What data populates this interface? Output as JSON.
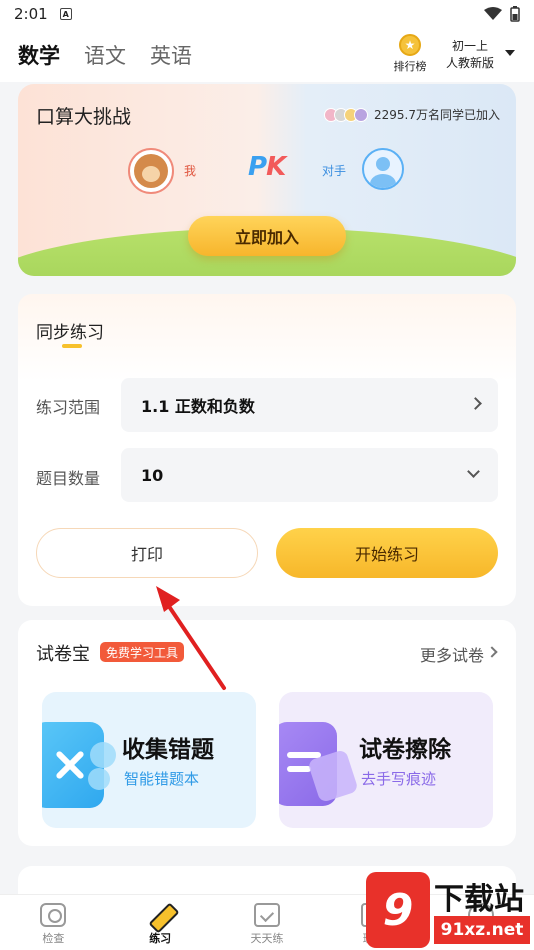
{
  "status_bar": {
    "time": "2:01",
    "app_badge": "A"
  },
  "header": {
    "tabs": [
      {
        "label": "数学",
        "active": true
      },
      {
        "label": "语文",
        "active": false
      },
      {
        "label": "英语",
        "active": false
      }
    ],
    "rank_label": "排行榜",
    "grade_line1": "初一上",
    "grade_line2": "人教新版"
  },
  "challenge": {
    "title": "口算大挑战",
    "joined_text": "2295.7万名同学已加入",
    "me_label": "我",
    "pk_p": "P",
    "pk_k": "K",
    "opponent_label": "对手",
    "join_button": "立即加入"
  },
  "practice": {
    "title": "同步练习",
    "range_label": "练习范围",
    "range_value": "1.1 正数和负数",
    "count_label": "题目数量",
    "count_value": "10",
    "print_button": "打印",
    "start_button": "开始练习"
  },
  "paper": {
    "title": "试卷宝",
    "badge": "免费学习工具",
    "more_link": "更多试卷",
    "tools": [
      {
        "title": "收集错题",
        "subtitle": "智能错题本"
      },
      {
        "title": "试卷擦除",
        "subtitle": "去手写痕迹"
      }
    ]
  },
  "bottom_nav": [
    {
      "label": "检查",
      "icon": "camera-icon",
      "active": false
    },
    {
      "label": "练习",
      "icon": "pencil-icon",
      "active": true
    },
    {
      "label": "天天练",
      "icon": "checklist-icon",
      "active": false
    },
    {
      "label": "班级",
      "icon": "class-icon",
      "active": false
    },
    {
      "label": "",
      "icon": "profile-icon",
      "active": false
    }
  ],
  "watermark": {
    "logo": "9",
    "text": "下载站",
    "url": "91xz.net"
  },
  "colors": {
    "accent_yellow": "#f7b72a",
    "annotation_red": "#e02020",
    "blue": "#2f9ae6",
    "purple": "#8a6ae8"
  }
}
